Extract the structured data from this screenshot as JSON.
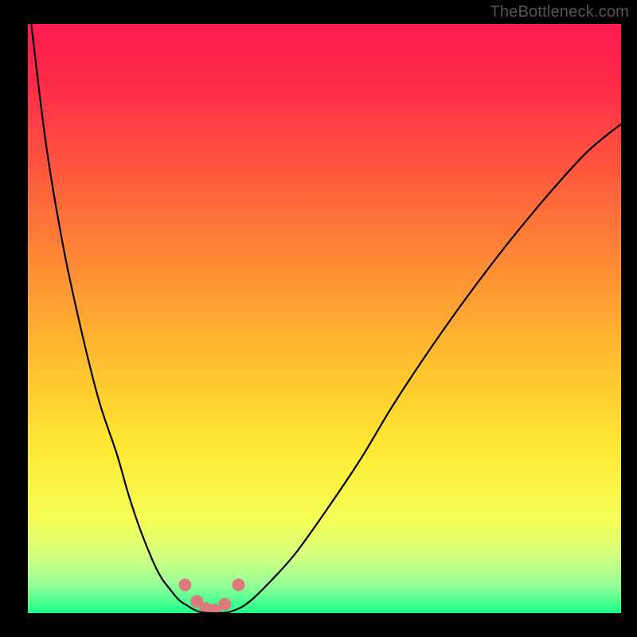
{
  "watermark": "TheBottleneck.com",
  "chart_data": {
    "type": "line",
    "title": "",
    "xlabel": "",
    "ylabel": "",
    "xrange": [
      0,
      100
    ],
    "yrange": [
      0,
      100
    ],
    "grid": false,
    "curves": [
      {
        "name": "left-branch",
        "color": "#000000",
        "x": [
          0,
          3,
          6,
          9,
          12,
          15,
          17,
          19,
          21,
          22.5,
          24,
          25.5,
          27,
          28,
          29
        ],
        "y": [
          105,
          80,
          62,
          48,
          36,
          27,
          20,
          14,
          9,
          6,
          4,
          2.2,
          1.2,
          0.6,
          0.2
        ]
      },
      {
        "name": "trough",
        "color": "#000000",
        "x": [
          29,
          30,
          31,
          32,
          33,
          34
        ],
        "y": [
          0.2,
          0.05,
          0.0,
          0.0,
          0.05,
          0.2
        ]
      },
      {
        "name": "right-branch",
        "color": "#000000",
        "x": [
          34,
          36,
          38,
          41,
          45,
          50,
          56,
          62,
          70,
          78,
          86,
          94,
          100
        ],
        "y": [
          0.2,
          1.0,
          2.5,
          5.5,
          10,
          17,
          26,
          36,
          48,
          59,
          69,
          78,
          83
        ]
      }
    ],
    "markers": {
      "name": "highlighted-points-near-minimum",
      "color": "#db7b7b",
      "radius_px": 8,
      "x": [
        26.5,
        28.5,
        30.0,
        31.5,
        33.2,
        35.5
      ],
      "y": [
        4.8,
        2.0,
        0.8,
        0.5,
        1.5,
        4.8
      ]
    },
    "gradient_stops": [
      {
        "offset": 0.0,
        "color": "#ff1a4f"
      },
      {
        "offset": 0.1,
        "color": "#ff2a4a"
      },
      {
        "offset": 0.22,
        "color": "#ff4f3f"
      },
      {
        "offset": 0.35,
        "color": "#ff7a38"
      },
      {
        "offset": 0.48,
        "color": "#ffa232"
      },
      {
        "offset": 0.6,
        "color": "#ffc72e"
      },
      {
        "offset": 0.72,
        "color": "#ffe934"
      },
      {
        "offset": 0.84,
        "color": "#f5ff55"
      },
      {
        "offset": 0.9,
        "color": "#d7ff7d"
      },
      {
        "offset": 0.95,
        "color": "#99ff97"
      },
      {
        "offset": 1.0,
        "color": "#1dff8a"
      }
    ]
  }
}
